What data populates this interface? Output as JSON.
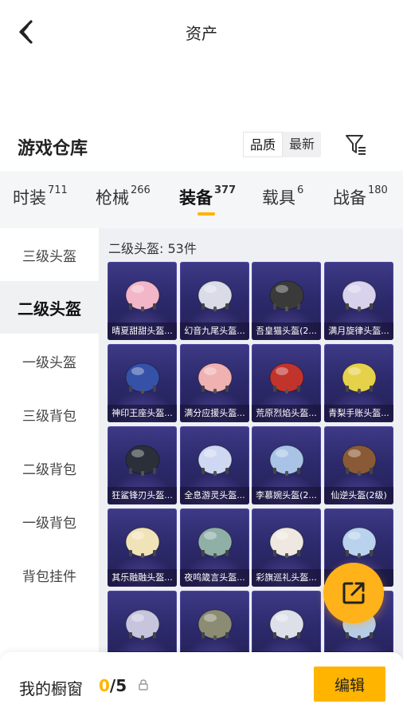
{
  "header": {
    "title": "资产",
    "back_icon": "back-chevron-icon"
  },
  "warehouse": {
    "title": "游戏仓库",
    "sort_options": [
      {
        "label": "品质",
        "active": true
      },
      {
        "label": "最新",
        "active": false
      }
    ],
    "filter_icon": "filter-icon"
  },
  "tabs": [
    {
      "label": "时装",
      "count": "711",
      "active": false
    },
    {
      "label": "枪械",
      "count": "266",
      "active": false
    },
    {
      "label": "装备",
      "count": "377",
      "active": true
    },
    {
      "label": "载具",
      "count": "6",
      "active": false
    },
    {
      "label": "战备",
      "count": "180",
      "active": false
    }
  ],
  "sidebar": {
    "items": [
      {
        "label": "三级头盔",
        "active": false
      },
      {
        "label": "二级头盔",
        "active": true
      },
      {
        "label": "一级头盔",
        "active": false
      },
      {
        "label": "三级背包",
        "active": false
      },
      {
        "label": "二级背包",
        "active": false
      },
      {
        "label": "一级背包",
        "active": false
      },
      {
        "label": "背包挂件",
        "active": false
      }
    ]
  },
  "content": {
    "section_title": "二级头盔: 53件",
    "items": [
      {
        "name": "晴夏甜甜头盔...",
        "color": "#f2b6c8"
      },
      {
        "name": "幻音九尾头盔...",
        "color": "#d9dbe6"
      },
      {
        "name": "吾皇猫头盔(2...",
        "color": "#3a3a3a"
      },
      {
        "name": "满月旋律头盔...",
        "color": "#d8d2ec"
      },
      {
        "name": "神印王座头盔...",
        "color": "#3552a8"
      },
      {
        "name": "满分应援头盔...",
        "color": "#f0b1b1"
      },
      {
        "name": "荒原烈焰头盔...",
        "color": "#c0342c"
      },
      {
        "name": "青梨手账头盔...",
        "color": "#e6d24a"
      },
      {
        "name": "狂鲨锋刃头盔...",
        "color": "#2b2f3a"
      },
      {
        "name": "全息游灵头盔...",
        "color": "#cfd8f2"
      },
      {
        "name": "李慕婉头盔(2...",
        "color": "#a9c3e6"
      },
      {
        "name": "仙逆头盔(2级)",
        "color": "#8a5a36"
      },
      {
        "name": "其乐融融头盔...",
        "color": "#f1e3b8"
      },
      {
        "name": "夜鸣箴言头盔...",
        "color": "#8fb0a6"
      },
      {
        "name": "彩旗巡礼头盔...",
        "color": "#eee8e0"
      },
      {
        "name": "",
        "color": "#b9d2ee"
      },
      {
        "name": "",
        "color": "#c7c5de"
      },
      {
        "name": "",
        "color": "#8c8c74"
      },
      {
        "name": "",
        "color": "#dde0e8"
      },
      {
        "name": "",
        "color": "#b5cdea"
      }
    ]
  },
  "fab": {
    "icon": "share-export-icon"
  },
  "bottom": {
    "showcase_label": "我的橱窗",
    "showcase_current": "0",
    "showcase_total": "/5",
    "lock_icon": "lock-icon",
    "edit_label": "编辑"
  }
}
